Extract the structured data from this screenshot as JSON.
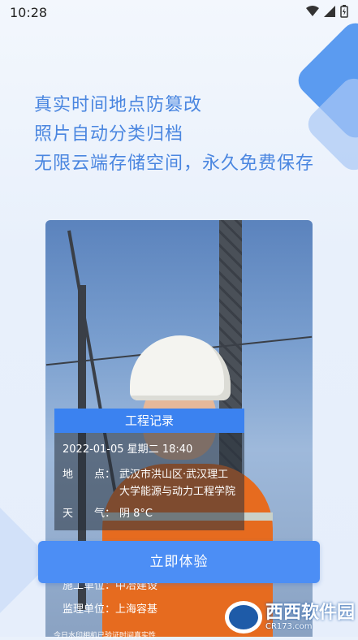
{
  "status_bar": {
    "time": "10:28"
  },
  "headline": {
    "line1": "真实时间地点防篡改",
    "line2": "照片自动分类归档",
    "line3": "无限云端存储空间，永久免费保存"
  },
  "record": {
    "title": "工程记录",
    "datetime": "2022-01-05 星期二 18:40",
    "location_label": "地　　点：",
    "location_value": "武汉市洪山区·武汉理工大学能源与动力工程学院",
    "weather_label": "天　　气：",
    "weather_value": "阴 8°C",
    "construction_label": "施工单位：",
    "construction_value": "中冶建设",
    "supervision_label": "监理单位：",
    "supervision_value": "上海容基"
  },
  "cta": {
    "label": "立即体验"
  },
  "footnote": "今日水印相机已验证时间真实性",
  "watermark": {
    "brand": "西西软件园",
    "url": "CR173.com"
  },
  "colors": {
    "accent": "#4c8ef5",
    "headline": "#4a86e0",
    "record_header": "#3b82f0"
  }
}
